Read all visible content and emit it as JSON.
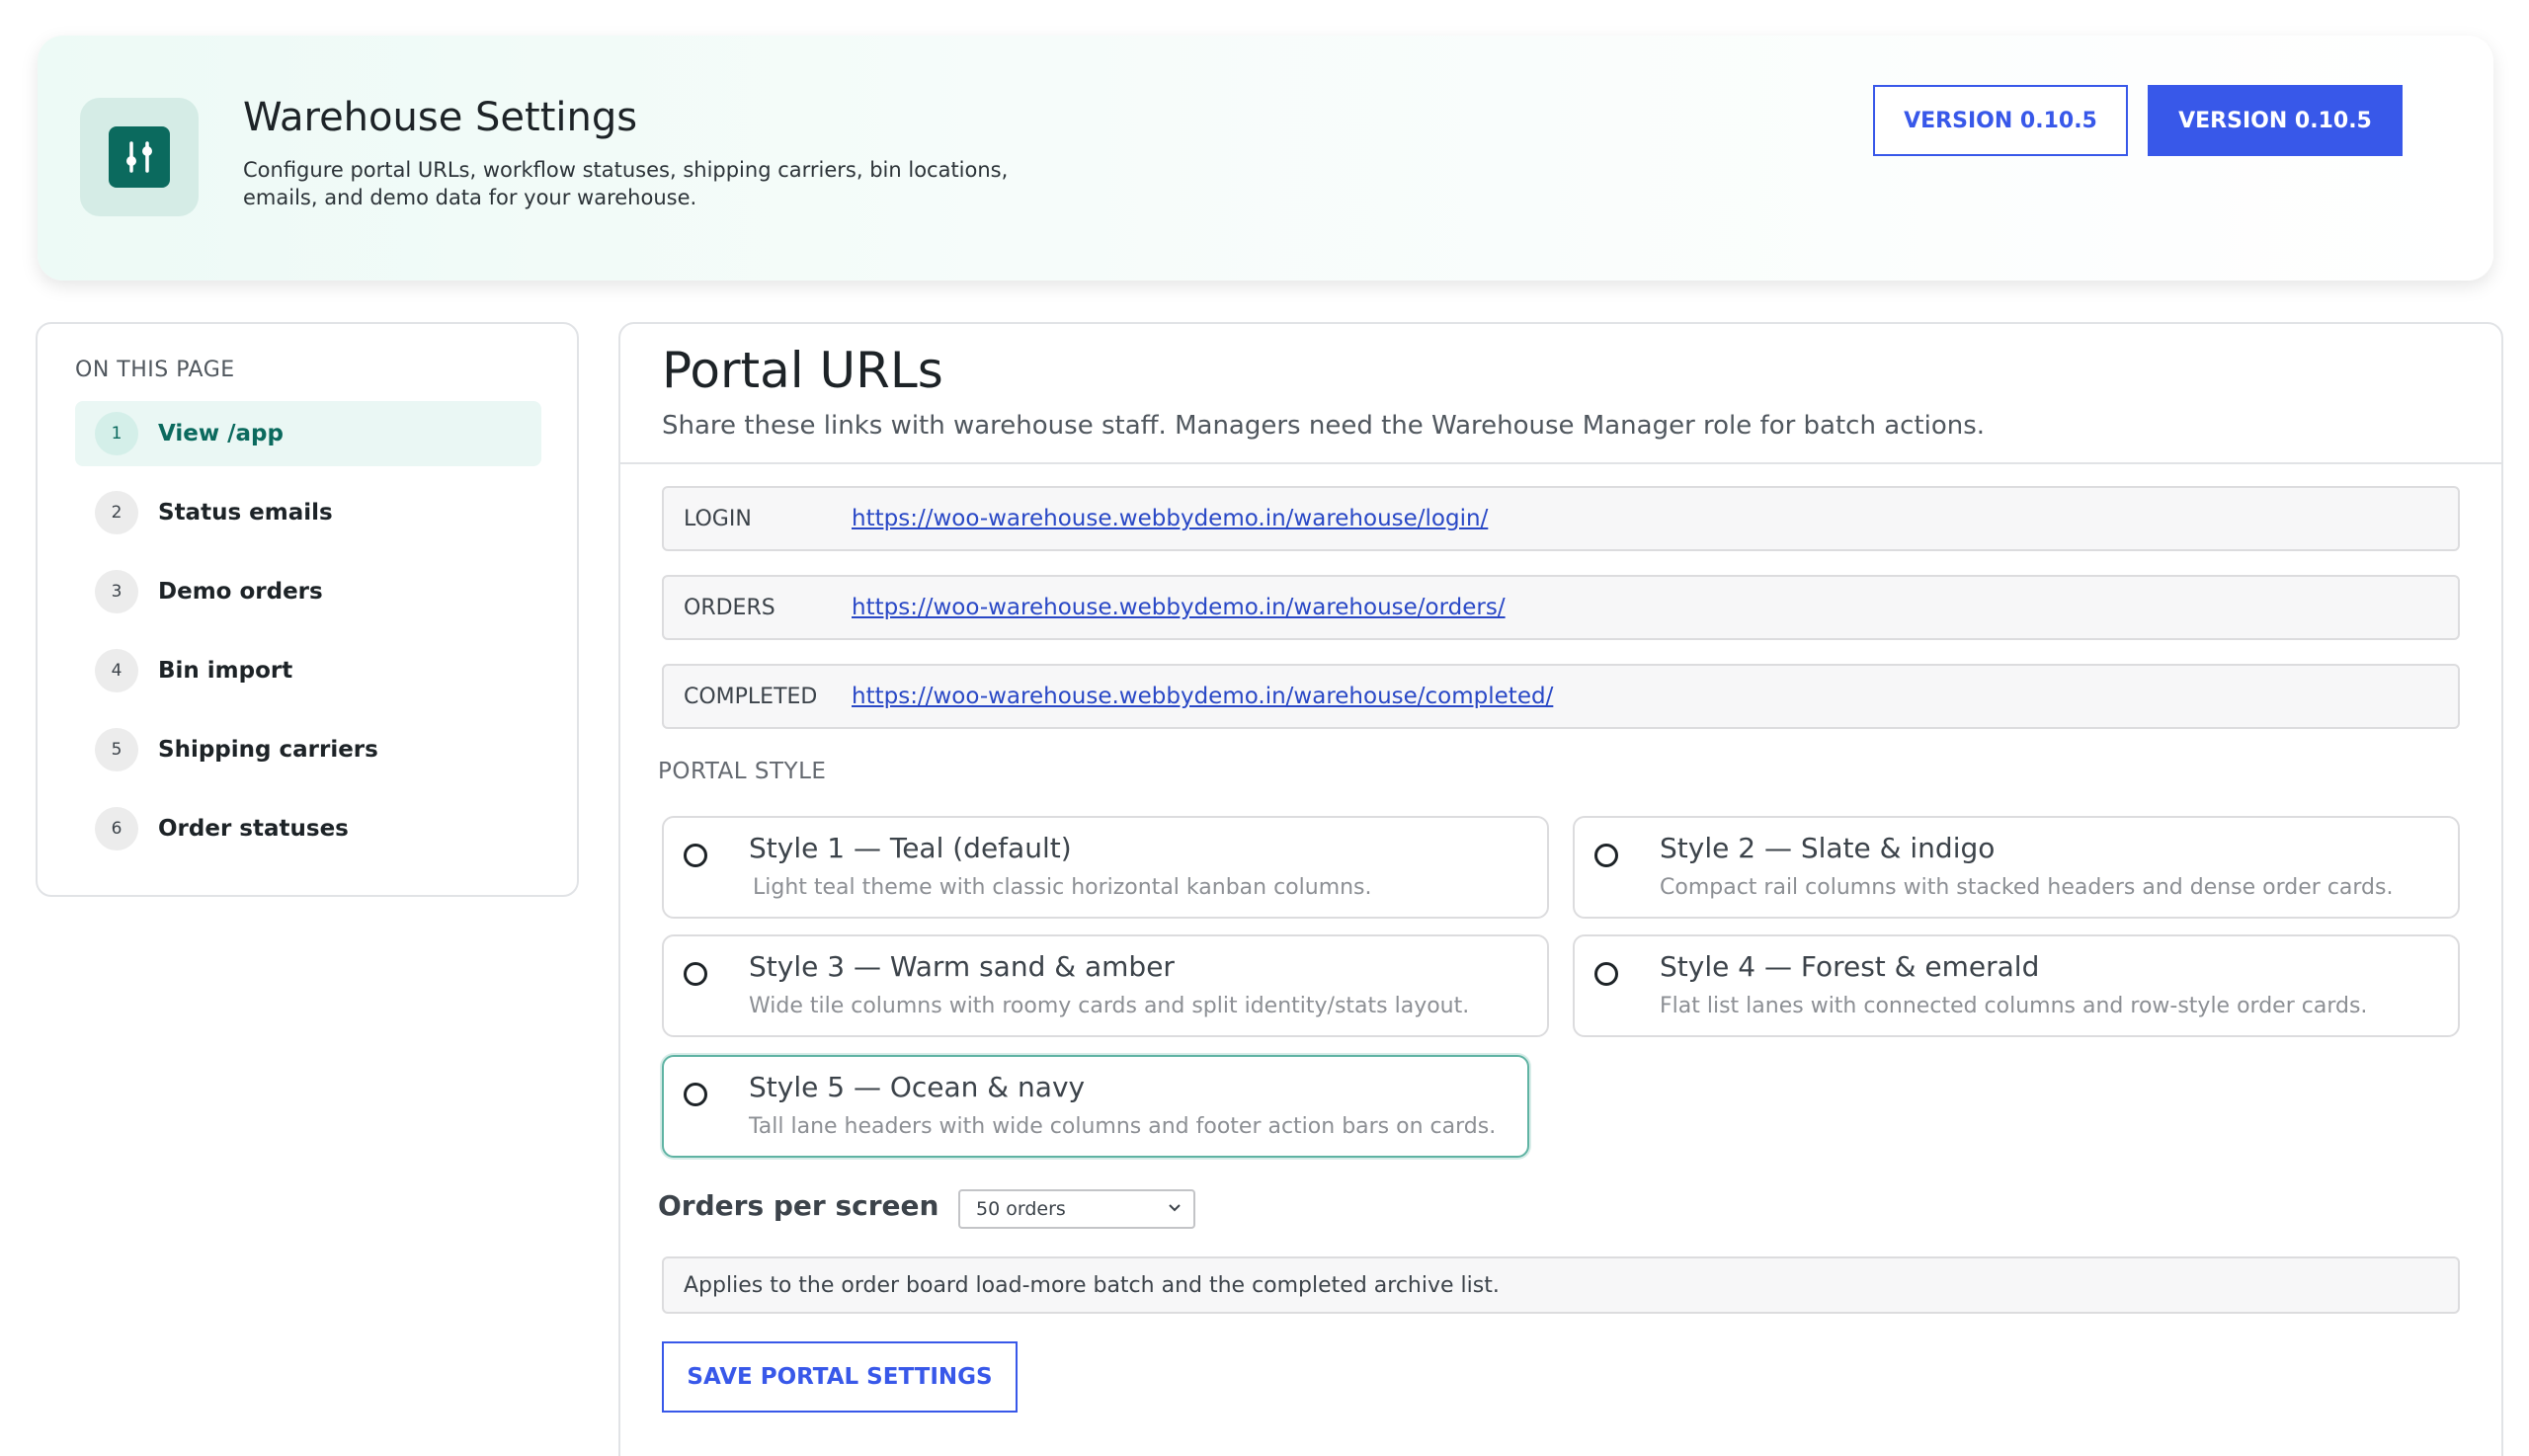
{
  "header": {
    "title": "Warehouse Settings",
    "description": "Configure portal URLs, workflow statuses, shipping carriers, bin locations, emails, and demo data for your warehouse.",
    "version_outline": "VERSION 0.10.5",
    "version_solid": "VERSION 0.10.5",
    "icon": "sliders-icon",
    "accent_color": "#0b6a5e",
    "button_color": "#3858e9"
  },
  "sidebar": {
    "heading": "ON THIS PAGE",
    "items": [
      {
        "num": "1",
        "label": "View /app",
        "active": true
      },
      {
        "num": "2",
        "label": "Status emails",
        "active": false
      },
      {
        "num": "3",
        "label": "Demo orders",
        "active": false
      },
      {
        "num": "4",
        "label": "Bin import",
        "active": false
      },
      {
        "num": "5",
        "label": "Shipping carriers",
        "active": false
      },
      {
        "num": "6",
        "label": "Order statuses",
        "active": false
      }
    ]
  },
  "main": {
    "title": "Portal URLs",
    "subtitle": "Share these links with warehouse staff. Managers need the Warehouse Manager role for batch actions.",
    "urls": [
      {
        "key": "LOGIN",
        "url": "https://woo-warehouse.webbydemo.in/warehouse/login/"
      },
      {
        "key": "ORDERS",
        "url": "https://woo-warehouse.webbydemo.in/warehouse/orders/"
      },
      {
        "key": "COMPLETED",
        "url": "https://woo-warehouse.webbydemo.in/warehouse/completed/"
      }
    ],
    "portal_style_label": "PORTAL STYLE",
    "styles": [
      {
        "name": "Style 1 — Teal (default)",
        "desc": "Light teal theme with classic horizontal kanban columns."
      },
      {
        "name": "Style 2 — Slate & indigo",
        "desc": "Compact rail columns with stacked headers and dense order cards."
      },
      {
        "name": "Style 3 — Warm sand & amber",
        "desc": "Wide tile columns with roomy cards and split identity/stats layout."
      },
      {
        "name": "Style 4 — Forest & emerald",
        "desc": "Flat list lanes with connected columns and row-style order cards."
      },
      {
        "name": "Style 5 — Ocean & navy",
        "desc": "Tall lane headers with wide columns and footer action bars on cards."
      }
    ],
    "orders_per_screen_label": "Orders per screen",
    "orders_per_screen_value": "50 orders",
    "orders_hint": "Applies to the order board load-more batch and the completed archive list.",
    "save_label": "SAVE PORTAL SETTINGS"
  }
}
